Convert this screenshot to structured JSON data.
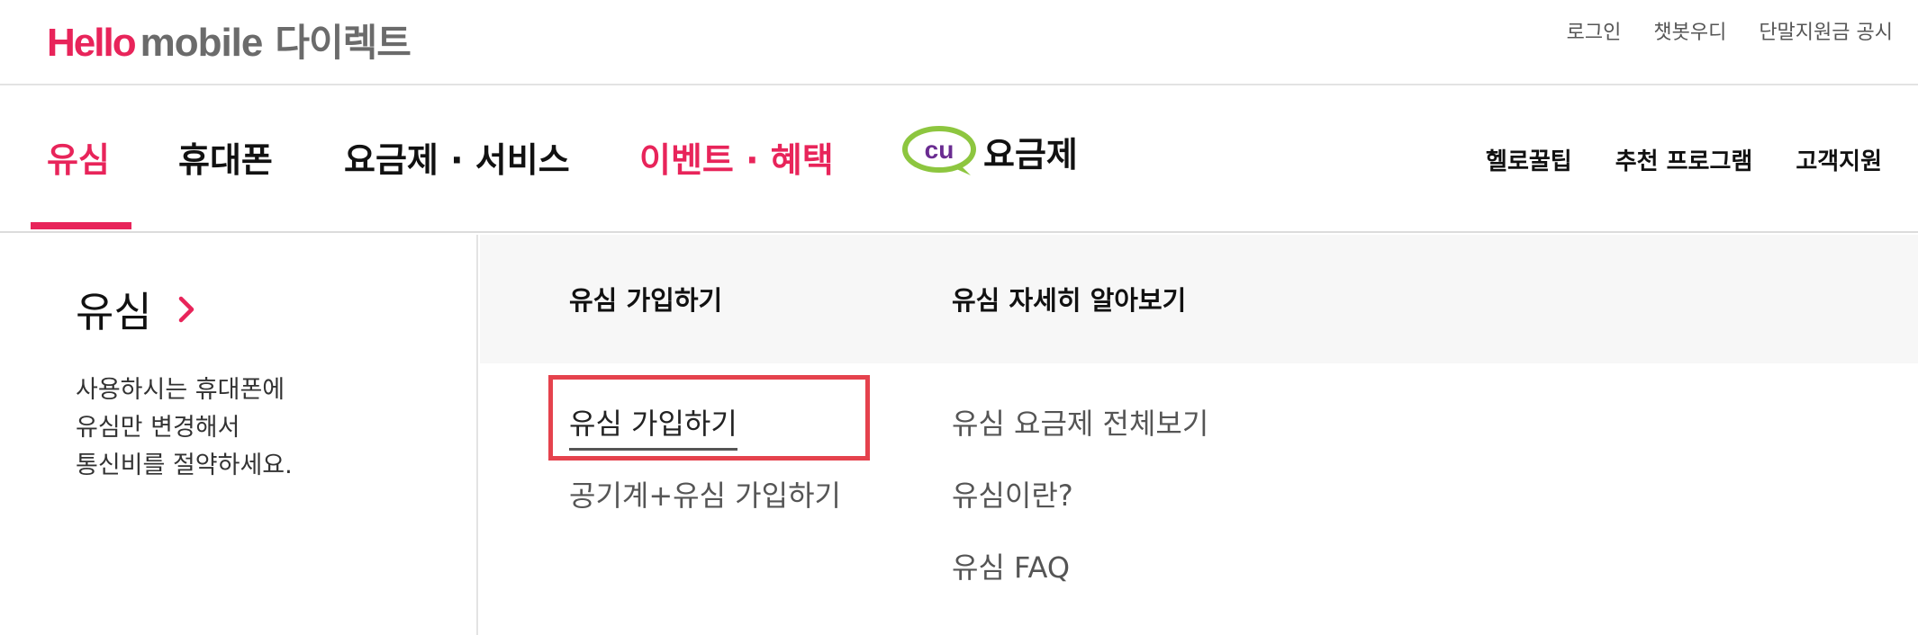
{
  "logo": {
    "hello": "Hello",
    "mobile": "mobile",
    "direct": "다이렉트"
  },
  "util_links": [
    "로그인",
    "챗봇우디",
    "단말지원금 공시"
  ],
  "gnb": {
    "items": [
      "유심",
      "휴대폰",
      "요금제 · 서비스",
      "이벤트 · 혜택"
    ],
    "cu_logo": "cu",
    "cu_label": "요금제",
    "right_links": [
      "헬로꿀팁",
      "추천 프로그램",
      "고객지원"
    ],
    "active_color": "#e8245a"
  },
  "mega": {
    "title": "유심",
    "description": [
      "사용하시는 휴대폰에",
      "유심만 변경해서",
      "통신비를 절약하세요."
    ],
    "columns": [
      {
        "heading": "유심 가입하기",
        "links": [
          "유심 가입하기",
          "공기계+유심 가입하기"
        ]
      },
      {
        "heading": "유심 자세히 알아보기",
        "links": [
          "유심 요금제 전체보기",
          "유심이란?",
          "유심 FAQ"
        ]
      }
    ]
  },
  "colors": {
    "brand_pink": "#e8245a",
    "cu_green": "#8dc63f",
    "cu_purple": "#6a2c91",
    "highlight_red": "#e5424d"
  }
}
